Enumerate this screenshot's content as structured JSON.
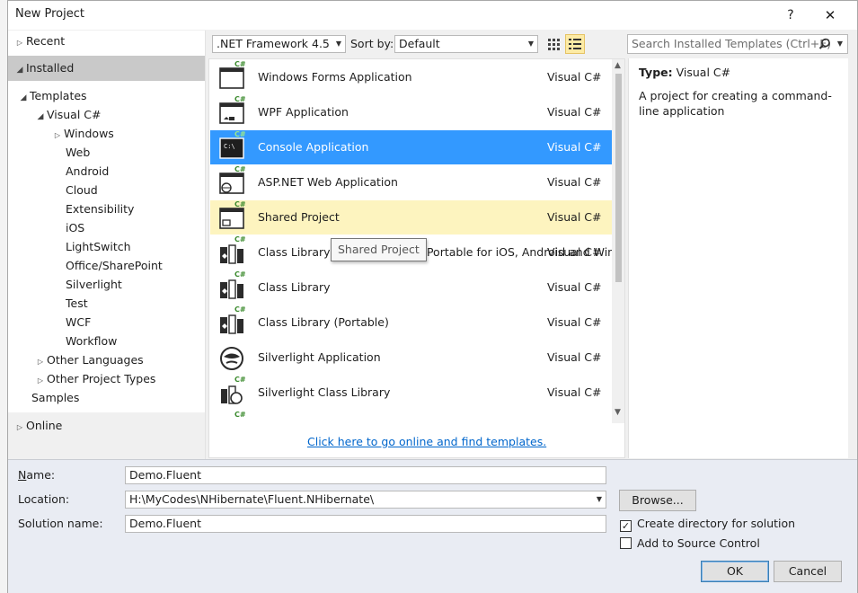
{
  "window": {
    "title": "New Project",
    "help": "?",
    "close": "✕"
  },
  "tree": {
    "recent": "Recent",
    "installed": "Installed",
    "templates": "Templates",
    "visual_csharp": "Visual C#",
    "children": [
      "Windows",
      "Web",
      "Android",
      "Cloud",
      "Extensibility",
      "iOS",
      "LightSwitch",
      "Office/SharePoint",
      "Silverlight",
      "Test",
      "WCF",
      "Workflow"
    ],
    "other_languages": "Other Languages",
    "other_project_types": "Other Project Types",
    "samples": "Samples",
    "online": "Online"
  },
  "toolbar": {
    "framework": ".NET Framework 4.5",
    "sort_label": "Sort by:",
    "sort_value": "Default",
    "search_placeholder": "Search Installed Templates (Ctrl+E)"
  },
  "templates": [
    {
      "name": "Windows Forms Application",
      "lang": "Visual C#",
      "icon": "windows-forms-icon"
    },
    {
      "name": "WPF Application",
      "lang": "Visual C#",
      "icon": "wpf-icon"
    },
    {
      "name": "Console Application",
      "lang": "Visual C#",
      "icon": "console-icon",
      "selected": true
    },
    {
      "name": "ASP.NET Web Application",
      "lang": "Visual C#",
      "icon": "web-app-icon"
    },
    {
      "name": "Shared Project",
      "lang": "Visual C#",
      "icon": "shared-project-icon",
      "hover": true
    },
    {
      "name": "Class Library (Xamarin.Forms Portable for iOS, Android and Windows)",
      "lang": "Visual C#",
      "icon": "class-library-icon"
    },
    {
      "name": "Class Library",
      "lang": "Visual C#",
      "icon": "class-library-icon"
    },
    {
      "name": "Class Library (Portable)",
      "lang": "Visual C#",
      "icon": "class-library-icon"
    },
    {
      "name": "Silverlight Application",
      "lang": "Visual C#",
      "icon": "silverlight-icon"
    },
    {
      "name": "Silverlight Class Library",
      "lang": "Visual C#",
      "icon": "silverlight-library-icon"
    }
  ],
  "tooltip": "Shared Project",
  "online_link": "Click here to go online and find templates.",
  "details": {
    "type_label": "Type:",
    "type_value": "Visual C#",
    "description": "A project for creating a command-line application"
  },
  "form": {
    "name_label": "Name:",
    "name_value": "Demo.Fluent",
    "location_label": "Location:",
    "location_value": "H:\\MyCodes\\NHibernate\\Fluent.NHibernate\\",
    "solution_label": "Solution name:",
    "solution_value": "Demo.Fluent",
    "browse": "Browse...",
    "create_directory": "Create directory for solution",
    "create_directory_checked": true,
    "add_source_control": "Add to Source Control",
    "add_source_control_checked": false,
    "ok": "OK",
    "cancel": "Cancel"
  }
}
